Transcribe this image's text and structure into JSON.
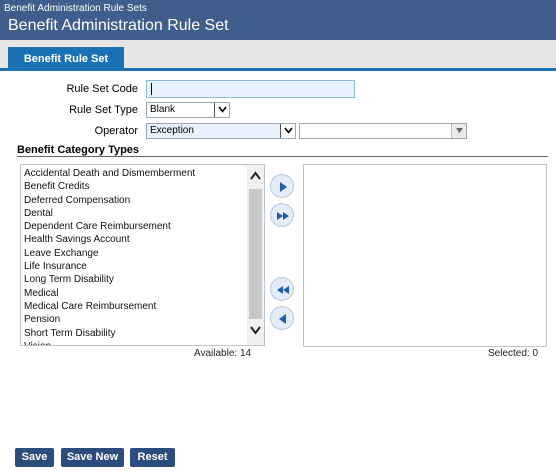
{
  "window": {
    "breadcrumb": "Benefit Administration Rule Sets",
    "title": "Benefit Administration Rule Set"
  },
  "tabs": [
    {
      "label": "Benefit Rule Set",
      "active": true
    }
  ],
  "form": {
    "rule_set_code": {
      "label": "Rule Set Code",
      "value": ""
    },
    "rule_set_type": {
      "label": "Rule Set Type",
      "value": "Blank"
    },
    "operator": {
      "label": "Operator",
      "value": "Exception",
      "secondary_value": ""
    }
  },
  "category_section": {
    "title": "Benefit Category Types",
    "available_items": [
      "Accidental Death and Dismemberment",
      "Benefit Credits",
      "Deferred Compensation",
      "Dental",
      "Dependent Care Reimbursement",
      "Health Savings Account",
      "Leave Exchange",
      "Life Insurance",
      "Long Term Disability",
      "Medical",
      "Medical Care Reimbursement",
      "Pension",
      "Short Term Disability",
      "Vision"
    ],
    "available_label": "Available: 14",
    "selected_label": "Selected: 0",
    "move_buttons": [
      "move-right-icon",
      "move-all-right-icon",
      "move-all-left-icon",
      "move-left-icon"
    ]
  },
  "buttons": {
    "save": "Save",
    "save_new": "Save New",
    "reset": "Reset"
  },
  "colors": {
    "header_bg": "#3f5e8c",
    "tab_accent": "#1a72b5",
    "button_bg": "#2c4c7c"
  }
}
